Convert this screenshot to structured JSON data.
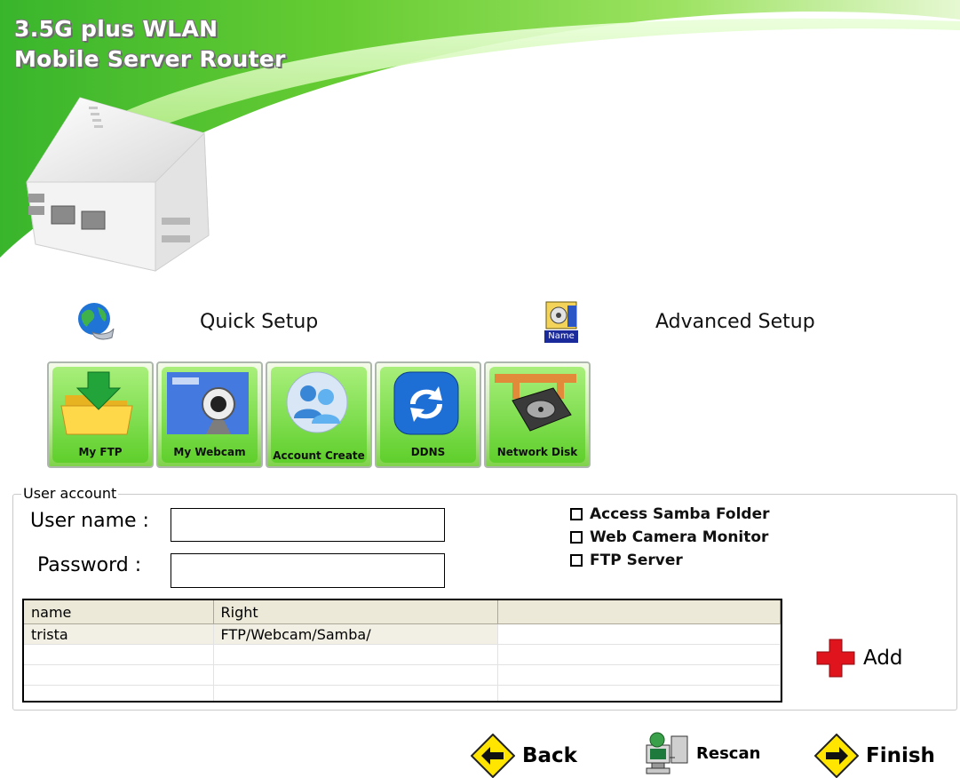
{
  "header": {
    "title_line1": "3.5G plus WLAN",
    "title_line2": "Mobile Server Router"
  },
  "setup": {
    "quick_label": "Quick Setup",
    "advanced_label": "Advanced Setup",
    "advanced_icon_text": "Name"
  },
  "toolbar": {
    "items": [
      {
        "label": "My FTP",
        "icon": "folder-download-icon"
      },
      {
        "label": "My Webcam",
        "icon": "webcam-icon"
      },
      {
        "label": "Account Create",
        "icon": "users-icon"
      },
      {
        "label": "DDNS",
        "icon": "refresh-icon"
      },
      {
        "label": "Network Disk",
        "icon": "hard-disk-icon"
      }
    ]
  },
  "account": {
    "legend": "User account",
    "username_label": "User name :",
    "username_value": "",
    "password_label": "Password :",
    "password_value": "",
    "options": [
      {
        "label": "Access Samba Folder",
        "checked": false
      },
      {
        "label": "Web Camera Monitor",
        "checked": false
      },
      {
        "label": "FTP Server",
        "checked": false
      }
    ],
    "table": {
      "columns": [
        "name",
        "Right",
        ""
      ],
      "rows": [
        [
          "trista",
          "FTP/Webcam/Samba/",
          ""
        ]
      ]
    },
    "add_label": "Add"
  },
  "nav": {
    "back_label": "Back",
    "rescan_label": "Rescan",
    "finish_label": "Finish"
  },
  "colors": {
    "brand_green": "#8ee04a",
    "accent_yellow": "#ffe500",
    "add_red": "#e0141c"
  }
}
